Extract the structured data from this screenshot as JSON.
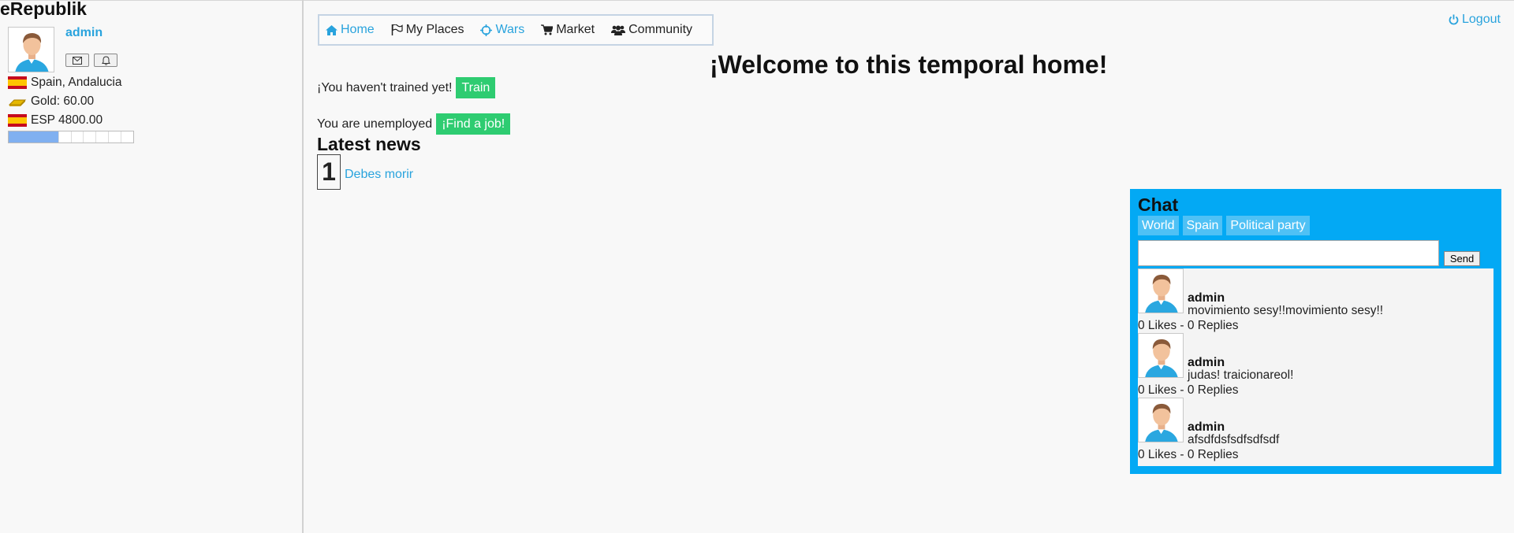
{
  "brand": "eRepublik",
  "user": {
    "name": "admin",
    "location": "Spain, Andalucia",
    "gold": "Gold: 60.00",
    "currency": "ESP 4800.00",
    "progress_fraction": 0.4
  },
  "nav": {
    "home": "Home",
    "places": "My Places",
    "wars": "Wars",
    "market": "Market",
    "community": "Community"
  },
  "logout": "Logout",
  "welcome": "¡Welcome to this temporal home!",
  "training": {
    "text": "¡You haven't trained yet!",
    "button": "Train"
  },
  "job": {
    "text": "You are unemployed",
    "button": "¡Find a job!"
  },
  "news": {
    "title": "Latest news",
    "number": "1",
    "item": "Debes morir"
  },
  "chat": {
    "title": "Chat",
    "tabs": [
      "World",
      "Spain",
      "Political party"
    ],
    "send": "Send",
    "messages": [
      {
        "user": "admin",
        "text": "movimiento sesy!!movimiento sesy!!",
        "meta": "0 Likes - 0 Replies"
      },
      {
        "user": "admin",
        "text": "judas! traicionareol!",
        "meta": "0 Likes - 0 Replies"
      },
      {
        "user": "admin",
        "text": "afsdfdsfsdfsdfsdf",
        "meta": "0 Likes - 0 Replies"
      }
    ]
  },
  "colors": {
    "accent": "#29a3dd",
    "green": "#2ecc71",
    "chat_bg": "#03a9f4"
  }
}
